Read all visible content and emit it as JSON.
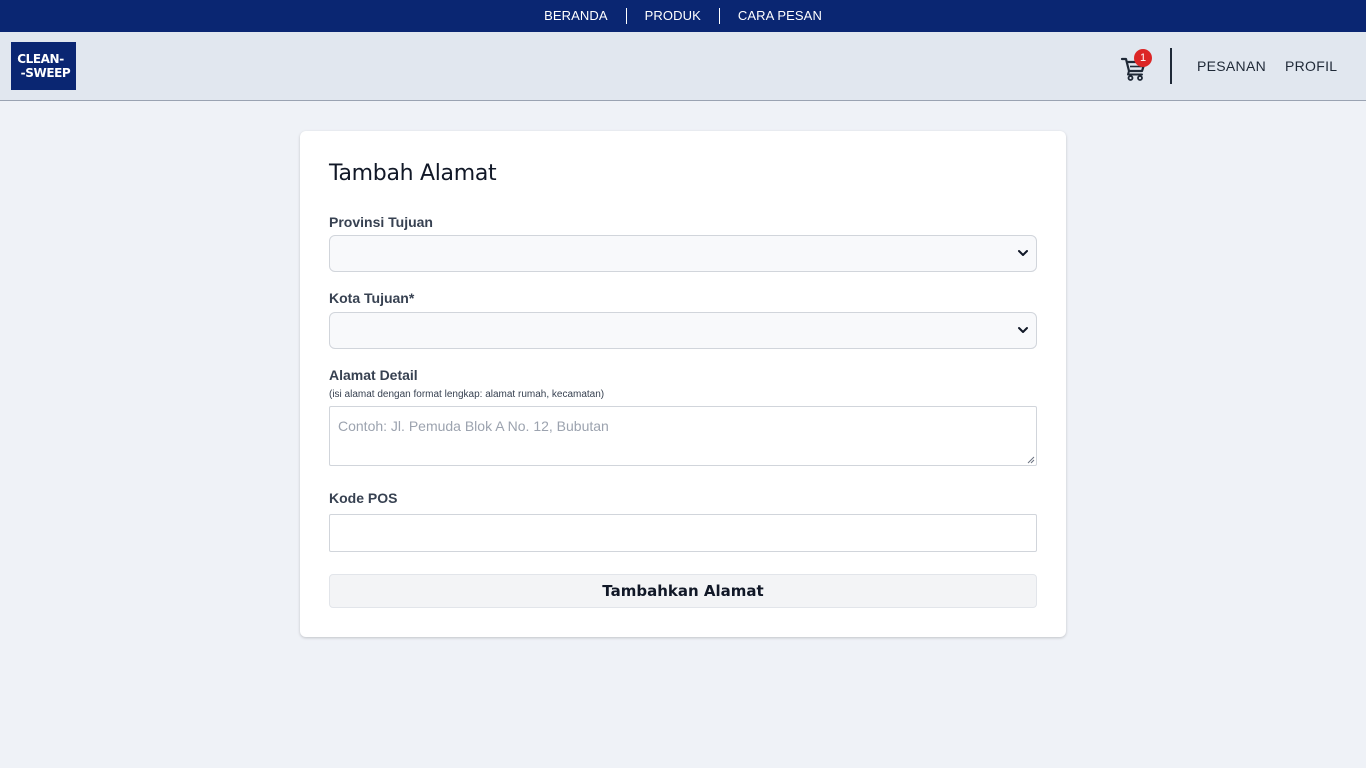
{
  "topnav": {
    "items": [
      "BERANDA",
      "PRODUK",
      "CARA PESAN"
    ]
  },
  "header": {
    "logo_line1": "CLEAN-",
    "logo_line2": "-SWEEP",
    "cart_count": "1",
    "links": [
      "PESANAN",
      "PROFIL"
    ]
  },
  "form": {
    "title": "Tambah Alamat",
    "province_label": "Provinsi Tujuan",
    "province_value": "",
    "city_label": "Kota Tujuan*",
    "city_value": "",
    "address_label": "Alamat Detail",
    "address_hint": "(isi alamat dengan format lengkap: alamat rumah, kecamatan)",
    "address_placeholder": "Contoh: Jl. Pemuda Blok A No. 12, Bubutan",
    "postal_label": "Kode POS",
    "postal_value": "",
    "submit_label": "Tambahkan Alamat"
  },
  "colors": {
    "brand_navy": "#0a2672",
    "badge_red": "#dc2626",
    "page_bg": "#eff2f7"
  },
  "icons": [
    "cart-icon",
    "chevron-down-icon",
    "resize-grip-icon"
  ]
}
